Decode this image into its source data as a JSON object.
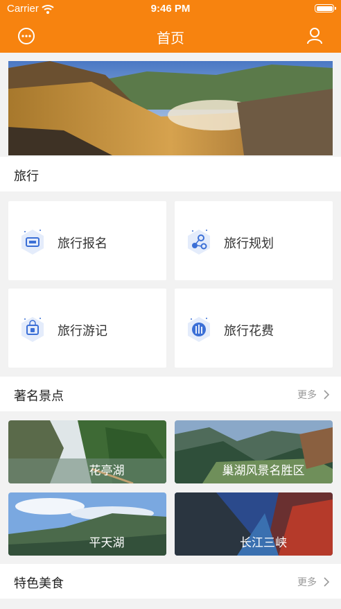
{
  "status": {
    "carrier": "Carrier",
    "time": "9:46 PM"
  },
  "nav": {
    "title": "首页",
    "left_icon": "message-icon",
    "right_icon": "user-icon"
  },
  "colors": {
    "brand": "#f7830f",
    "icon_blue": "#3b6fd6"
  },
  "travel": {
    "title": "旅行",
    "items": [
      {
        "label": "旅行报名",
        "icon": "ticket-icon"
      },
      {
        "label": "旅行规划",
        "icon": "route-icon"
      },
      {
        "label": "旅行游记",
        "icon": "lock-note-icon"
      },
      {
        "label": "旅行花费",
        "icon": "cost-icon"
      }
    ]
  },
  "spots": {
    "title": "著名景点",
    "more": "更多",
    "items": [
      {
        "label": "花亭湖"
      },
      {
        "label": "巢湖风景名胜区"
      },
      {
        "label": "平天湖"
      },
      {
        "label": "长江三峡"
      }
    ]
  },
  "food": {
    "title": "特色美食",
    "more": "更多"
  }
}
